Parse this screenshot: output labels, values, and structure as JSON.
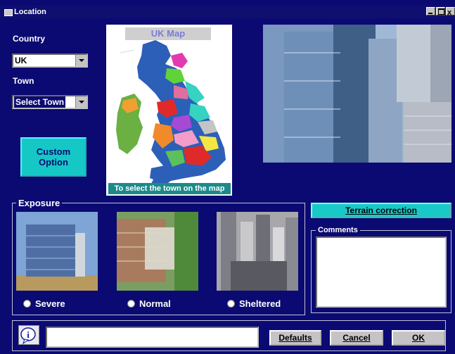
{
  "window": {
    "title": "Location",
    "controls": [
      "minimize-icon",
      "maximize-icon",
      "close-icon"
    ]
  },
  "location": {
    "country_label": "Country",
    "country_value": "UK",
    "town_label": "Town",
    "town_value": "Select Town",
    "custom_option_line1": "Custom",
    "custom_option_line2": "Option"
  },
  "map": {
    "title": "UK Map",
    "caption": "To select the town on the map"
  },
  "exposure": {
    "legend": "Exposure",
    "options": [
      {
        "label": "Severe"
      },
      {
        "label": "Normal"
      },
      {
        "label": "Sheltered"
      }
    ]
  },
  "terrain": {
    "button_label": "Terrain correction"
  },
  "comments": {
    "legend": "Comments",
    "value": ""
  },
  "footer": {
    "message": "",
    "defaults_label": "Defaults",
    "cancel_label": "Cancel",
    "ok_label": "OK"
  },
  "colors": {
    "window_bg": "#0b0a72",
    "accent_teal": "#19c9c8",
    "button_gray": "#c6c3c6"
  }
}
